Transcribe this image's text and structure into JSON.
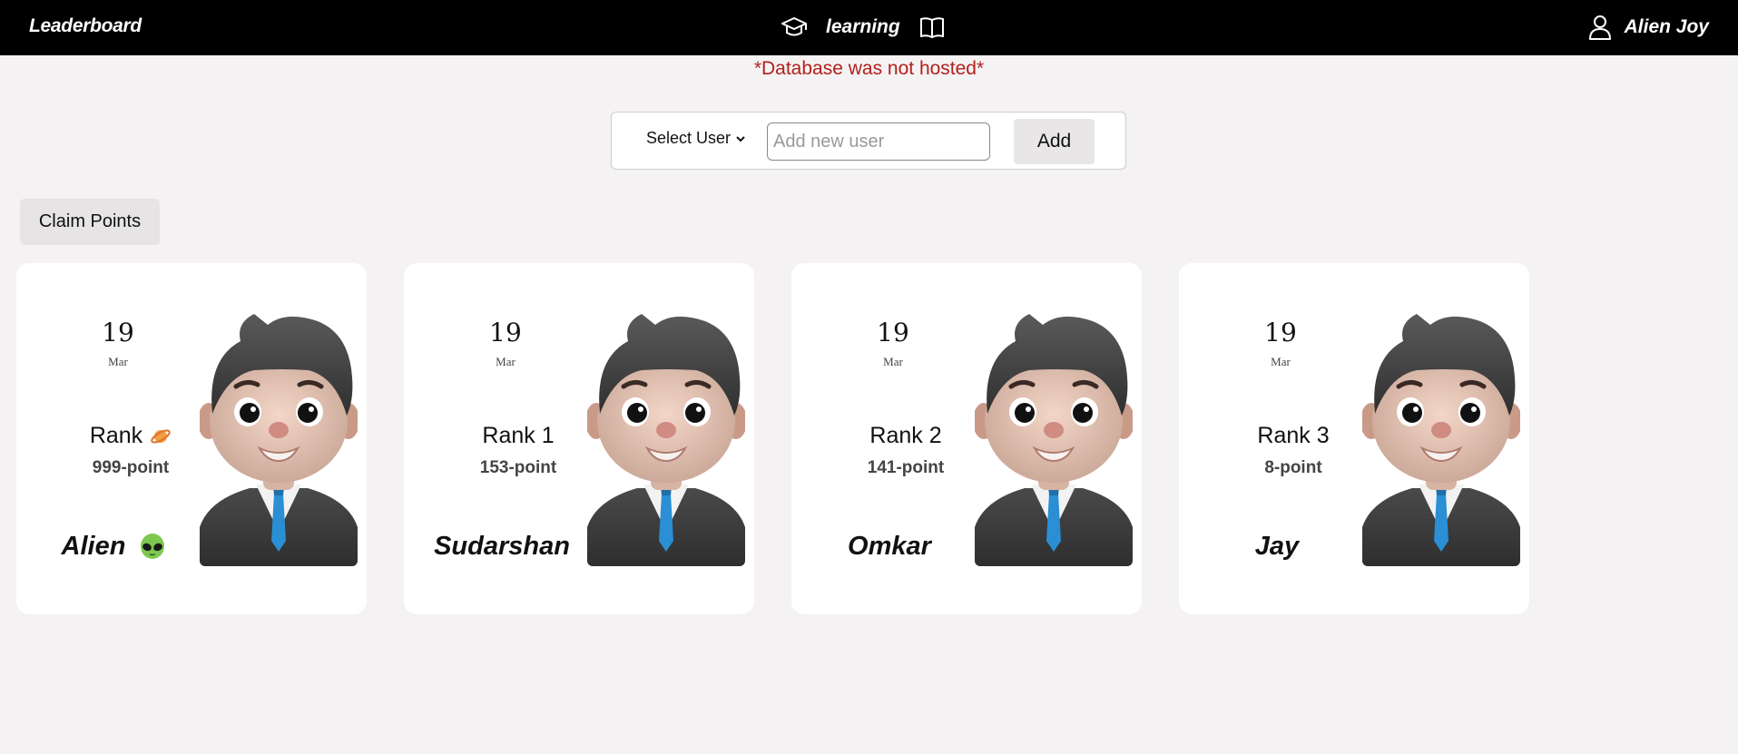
{
  "navbar": {
    "brand": "Leaderboard",
    "center_label": "learning",
    "user_name": "Alien Joy",
    "icons": [
      "graduation-cap-icon",
      "open-book-icon",
      "user-icon"
    ]
  },
  "warning": "*Database was not hosted*",
  "add_user": {
    "select_label": "Select User",
    "input_placeholder": "Add new user",
    "input_value": "",
    "add_label": "Add"
  },
  "claim_label": "Claim Points",
  "cards": [
    {
      "day": "19",
      "month": "Mar",
      "rank": "Rank",
      "rank_icon": "planet-icon",
      "points": "999-point",
      "name": "Alien",
      "name_icon": "alien-emoji-icon"
    },
    {
      "day": "19",
      "month": "Mar",
      "rank": "Rank 1",
      "points": "153-point",
      "name": "Sudarshan"
    },
    {
      "day": "19",
      "month": "Mar",
      "rank": "Rank 2",
      "points": "141-point",
      "name": "Omkar"
    },
    {
      "day": "19",
      "month": "Mar",
      "rank": "Rank 3",
      "points": "8-point",
      "name": "Jay"
    }
  ],
  "colors": {
    "navbar_bg": "#000000",
    "page_bg": "#f4f2f3",
    "warning": "#b3201c",
    "card_bg": "#ffffff"
  }
}
